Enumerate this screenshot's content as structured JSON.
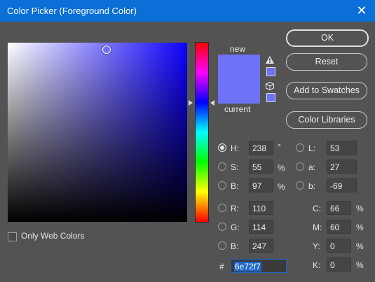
{
  "window": {
    "title": "Color Picker (Foreground Color)",
    "close_glyph": "✕"
  },
  "color": {
    "hex_value": "#6e72f7",
    "picker_saturation": 55,
    "picker_brightness": 97,
    "hue_degrees": 238
  },
  "swatch_labels": {
    "new": "new",
    "current": "current"
  },
  "buttons": {
    "ok": "OK",
    "reset": "Reset",
    "add_to_swatches": "Add to Swatches",
    "color_libraries": "Color Libraries"
  },
  "hsb": {
    "h_label": "H:",
    "h_value": "238",
    "h_unit": "°",
    "s_label": "S:",
    "s_value": "55",
    "s_unit": "%",
    "b_label": "B:",
    "b_value": "97",
    "b_unit": "%"
  },
  "lab": {
    "l_label": "L:",
    "l_value": "53",
    "a_label": "a:",
    "a_value": "27",
    "b_label": "b:",
    "b_value": "-69"
  },
  "rgb": {
    "r_label": "R:",
    "r_value": "110",
    "g_label": "G:",
    "g_value": "114",
    "b_label": "B:",
    "b_value": "247"
  },
  "cmyk": {
    "c_label": "C:",
    "c_value": "66",
    "c_unit": "%",
    "m_label": "M:",
    "m_value": "60",
    "m_unit": "%",
    "y_label": "Y:",
    "y_value": "0",
    "y_unit": "%",
    "k_label": "K:",
    "k_value": "0",
    "k_unit": "%"
  },
  "hex": {
    "prefix": "#",
    "value": "6e72f7"
  },
  "web_colors": {
    "label": "Only Web Colors",
    "checked": false
  }
}
